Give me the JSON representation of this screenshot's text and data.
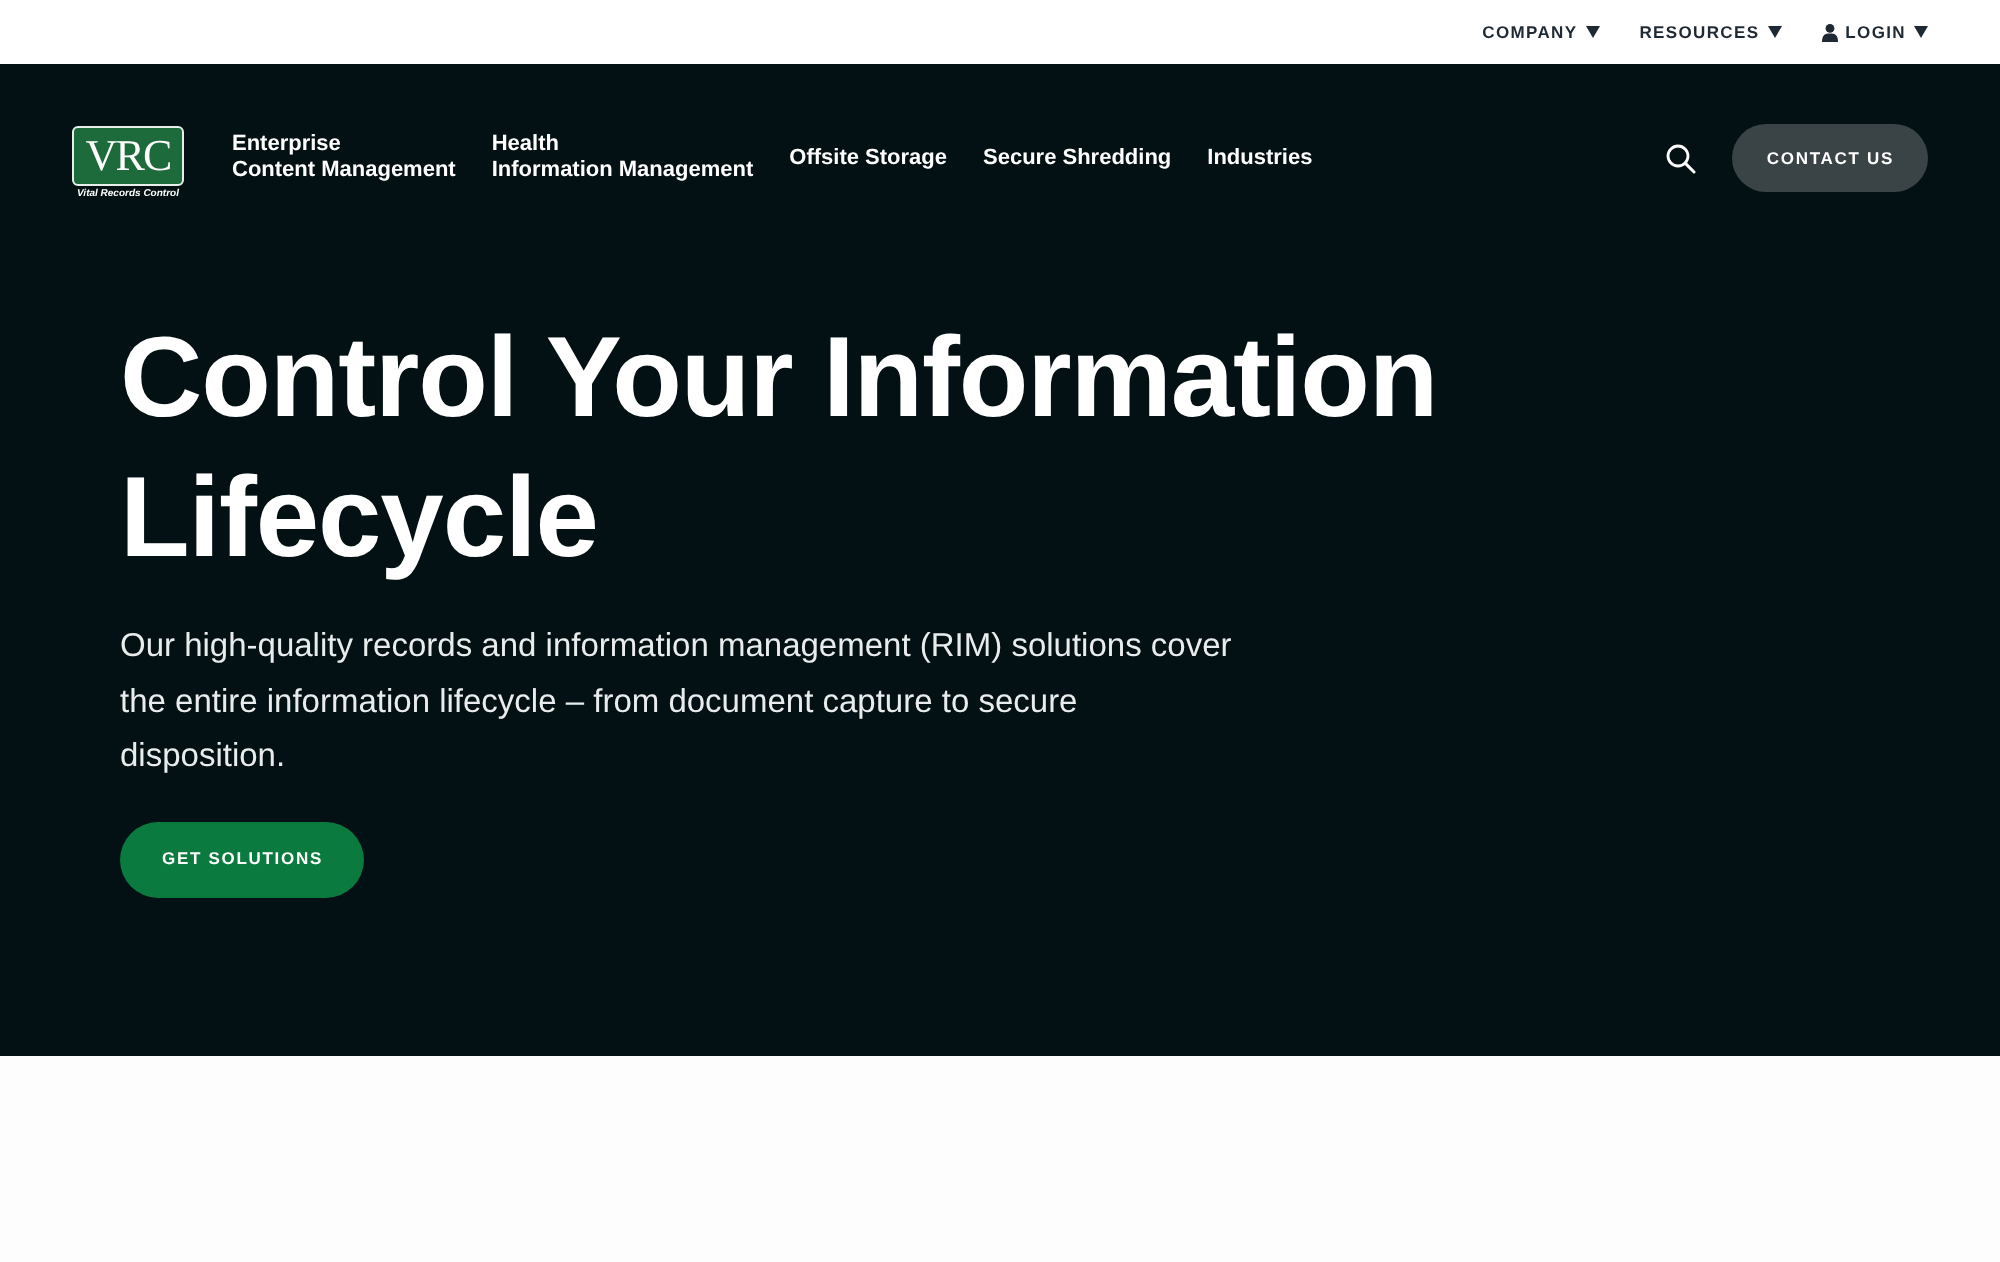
{
  "top_bar": {
    "items": [
      {
        "label": "COMPANY",
        "kind": "dropdown"
      },
      {
        "label": "RESOURCES",
        "kind": "dropdown"
      },
      {
        "label": "LOGIN",
        "kind": "account"
      }
    ]
  },
  "header": {
    "logo": {
      "mark": "VRC",
      "tagline": "Vital Records Control"
    },
    "nav": [
      {
        "lines": [
          "Enterprise",
          "Content Management"
        ]
      },
      {
        "lines": [
          "Health",
          "Information Management"
        ]
      },
      {
        "lines": [
          "Offsite Storage"
        ]
      },
      {
        "lines": [
          "Secure Shredding"
        ]
      },
      {
        "lines": [
          "Industries"
        ]
      }
    ],
    "contact_button": "CONTACT US"
  },
  "hero": {
    "title": "Control Your Information Lifecycle",
    "text": "Our high-quality records and information management (RIM) solutions cover the entire information lifecycle – from document capture to secure disposition.",
    "button": "GET SOLUTIONS"
  }
}
